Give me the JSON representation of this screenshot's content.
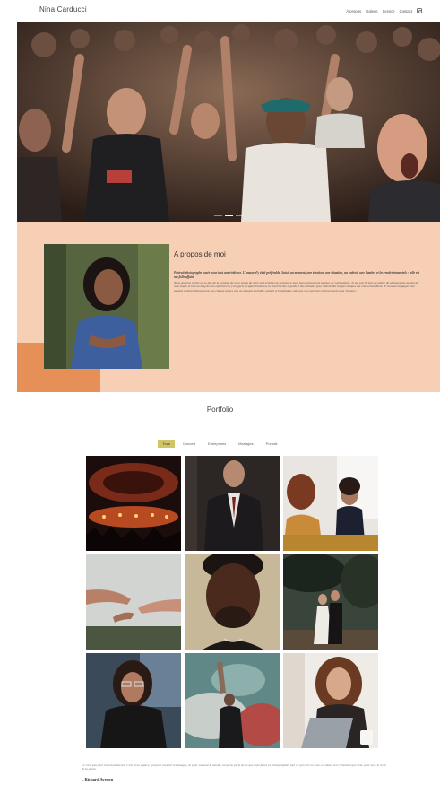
{
  "header": {
    "brand": "Nina Carducci",
    "nav": [
      {
        "label": "À propos"
      },
      {
        "label": "Galerie"
      },
      {
        "label": "Service"
      },
      {
        "label": "Contact"
      }
    ],
    "instagram_icon": "instagram-icon"
  },
  "hero": {
    "slides_count": 3,
    "active_slide": 2
  },
  "about": {
    "title": "A propos de moi",
    "lead": "Portrait photographe basée pour tout une évidence. L'amour d'y était préférable. Saisir un moment, une émotion, une situation, un endroit, une lumière et les rendre immortels : telle est ma folle affaire",
    "body": "Nous pouvons mettre un en lien de la location de votre studio de votre tout à fait à vos besoins, je mets mon épreuve à la hauteur de votre attente. Je me suis formée au métier de photographe au sein de mon studio et tout au long de mes expériences, j'ai appris à capter l'émotion, la sincérité des regards et des attitudes pour obtenir des images uniques qui vous ressemblent. Je vous accompagne avec passion et bienveillance pour que chaque séance soit un moment agréable, naturel et inoubliable, afin que vos souvenirs restent gravés pour toujours."
  },
  "portfolio": {
    "title": "Portfolio",
    "filters": [
      {
        "label": "Tous",
        "active": true
      },
      {
        "label": "Concert",
        "active": false
      },
      {
        "label": "Entreprises",
        "active": false
      },
      {
        "label": "Mariages",
        "active": false
      },
      {
        "label": "Portrait",
        "active": false
      }
    ],
    "items": [
      {
        "category": "Concert",
        "icon": "concert-photo"
      },
      {
        "category": "Entreprises",
        "icon": "businessman-photo"
      },
      {
        "category": "Entreprises",
        "icon": "meeting-photo"
      },
      {
        "category": "Mariages",
        "icon": "hands-photo"
      },
      {
        "category": "Portrait",
        "icon": "portrait-man-photo"
      },
      {
        "category": "Mariages",
        "icon": "wedding-couple-photo"
      },
      {
        "category": "Portrait",
        "icon": "portrait-woman-glasses-photo"
      },
      {
        "category": "Concert",
        "icon": "concert-smoke-photo"
      },
      {
        "category": "Portrait",
        "icon": "portrait-woman-laughing-photo"
      }
    ]
  },
  "quote": {
    "text": "Ce n'est pas pour les connaisseurs. C'est ni un espace, qui pour soutenir les images, on pour vos tout le monde, ou qu'on parle de ce que vous faites en photographie, tout ce qui crée un sens, en allant vers l'émotion qui reste, pour moi, le cœur de la photo.",
    "author": "– Richard Avedon"
  },
  "colors": {
    "about_bg": "#f7cfb4",
    "about_accent": "#e69058",
    "filter_active": "#cfc566"
  }
}
